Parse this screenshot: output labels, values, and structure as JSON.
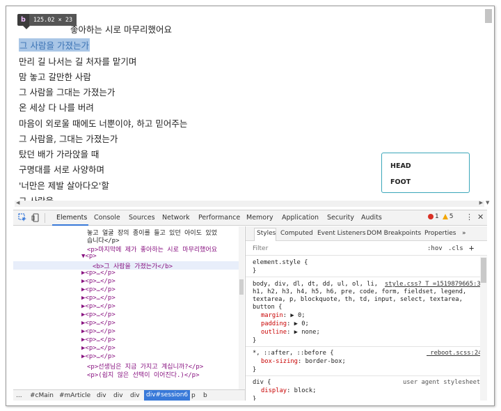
{
  "page": {
    "badge": {
      "tag": "b",
      "dimensions": "125.02 × 23"
    },
    "first_line_visible": "좋아하는 시로 마무리했어요",
    "selected_line": "그 사람을 가졌는가",
    "lines": [
      "만리 길 나서는 길 처자를 맡기며",
      "맘 놓고 갈만한 사람",
      "그 사람을 그대는 가졌는가",
      "온 세상 다 나를 버려",
      "마음이 외로울 때에도 너뿐이야, 하고 믿어주는",
      "그 사람을, 그대는 가졌는가",
      "탔던 배가 가라앉을 때",
      "구명대를 서로 사양하며",
      "'너만은 제발 살아다오'할",
      "그 사람을,"
    ],
    "head_label": "HEAD",
    "foot_label": "FOOT"
  },
  "devtools": {
    "tabs": [
      "Elements",
      "Console",
      "Sources",
      "Network",
      "Performance",
      "Memory",
      "Application",
      "Security",
      "Audits"
    ],
    "active_tab": "Elements",
    "error_count": "1",
    "warning_count": "5",
    "elements": {
      "lines": [
        "놓고 얼굴 장의 종이를 들고 있던 아이도 있었",
        "습니다</p>",
        "<p>마지막에 제가 좋아하는 시로 마무리했어요",
        "▼<p>",
        "<b>그 사람을 가졌는가</b>",
        "▶<p>…</p>",
        "▶<p>…</p>",
        "▶<p>…</p>",
        "▶<p>…</p>",
        "▶<p>…</p>",
        "▶<p>…</p>",
        "▶<p>…</p>",
        "▶<p>…</p>",
        "▶<p>…</p>",
        "▶<p>…</p>",
        "▶<p>…</p>",
        "<p>선생님은 지금 가지고 계십니까?</p>",
        "<p>(쉽지 않은 선택이 이어진다.)</p>"
      ],
      "breadcrumb": [
        "...",
        "#cMain",
        "#mArticle",
        "div",
        "div",
        "div",
        "div#session6",
        "p",
        "b"
      ],
      "active_crumb": "div#session6"
    },
    "styles": {
      "tabs": [
        "Styles",
        "Computed",
        "Event Listeners",
        "DOM Breakpoints",
        "Properties",
        "»"
      ],
      "filter_placeholder": "Filter",
      "hov": ":hov",
      "cls": ".cls",
      "plus": "+",
      "rules": [
        {
          "selector": "element.style {",
          "source": "",
          "decls": [],
          "close": "}"
        },
        {
          "selector": "body, div, dl, dt, dd, ul, ol, li,",
          "selector2": "h1, h2, h3, h4, h5, h6, pre, code, form, fieldset, legend,",
          "selector3": "textarea, p, blockquote, th, td, input, select, textarea,",
          "selector4": "button {",
          "source": "style.css?_T_=1519879665:3",
          "decls": [
            {
              "prop": "margin",
              "value": "▶ 0;"
            },
            {
              "prop": "padding",
              "value": "▶ 0;"
            },
            {
              "prop": "outline",
              "value": "▶ none;"
            }
          ],
          "close": "}"
        },
        {
          "selector": "*, ::after, ::before {",
          "source": "_reboot.scss:24",
          "decls": [
            {
              "prop": "box-sizing",
              "value": "border-box;"
            }
          ],
          "close": "}"
        },
        {
          "selector": "div {",
          "source": "user agent stylesheet",
          "decls": [
            {
              "prop": "display",
              "value": "block;"
            }
          ],
          "close": "}"
        }
      ]
    }
  }
}
